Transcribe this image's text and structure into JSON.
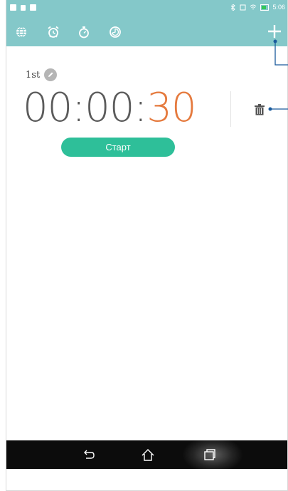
{
  "status_bar": {
    "right_text": "5:06"
  },
  "toolbar": {
    "tabs": [
      {
        "icon": "globe-icon",
        "label": "World clock"
      },
      {
        "icon": "alarm-clock-icon",
        "label": "Alarm"
      },
      {
        "icon": "stopwatch-icon",
        "label": "Stopwatch"
      },
      {
        "icon": "timer-icon",
        "label": "Timer"
      }
    ],
    "add_icon": "plus-icon"
  },
  "timer": {
    "label": "1st",
    "time_prefix": "00:00:",
    "seconds": "30",
    "start_label": "Старт"
  },
  "colors": {
    "accent": "#84c8c9",
    "start_button": "#2ebf99",
    "seconds": "#e57a3e",
    "time": "#5b5b5b"
  },
  "navigation": {
    "buttons": [
      "back-icon",
      "home-icon",
      "recent-apps-icon"
    ]
  }
}
